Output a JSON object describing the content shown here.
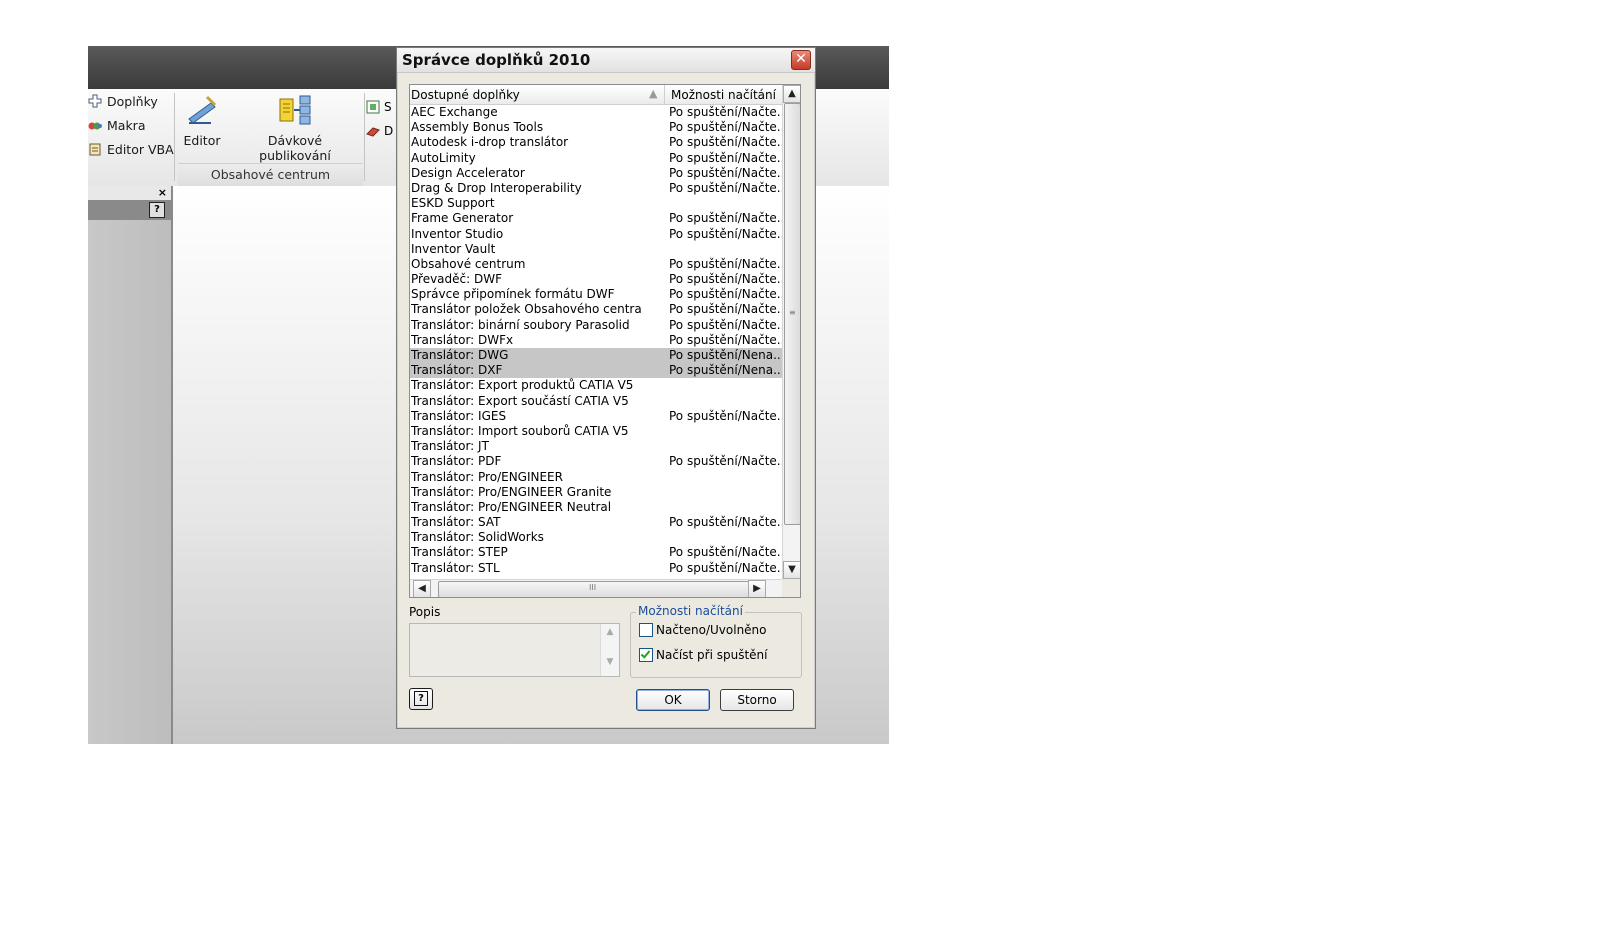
{
  "app": {
    "ribbon": {
      "small_items": [
        {
          "label": "Doplňky",
          "icon": "plus-icon"
        },
        {
          "label": "Makra",
          "icon": "macro-icon"
        },
        {
          "label": "Editor VBA",
          "icon": "vba-icon"
        }
      ],
      "big_buttons": [
        {
          "label": "Editor",
          "icon": "editor-pen-icon"
        },
        {
          "label": "Dávkové publikování",
          "icon": "batch-publish-icon"
        }
      ],
      "group_label": "Obsahové centrum",
      "partial_items": [
        "S",
        "D"
      ]
    }
  },
  "dialog": {
    "title": "Správce doplňků 2010",
    "columns": {
      "name": "Dostupné doplňky",
      "load": "Možnosti načítání"
    },
    "rows": [
      {
        "name": "AEC Exchange",
        "load": "Po spuštění/Načte..."
      },
      {
        "name": "Assembly Bonus Tools",
        "load": "Po spuštění/Načte..."
      },
      {
        "name": "Autodesk i-drop translátor",
        "load": "Po spuštění/Načte..."
      },
      {
        "name": "AutoLimity",
        "load": "Po spuštění/Načte..."
      },
      {
        "name": "Design Accelerator",
        "load": "Po spuštění/Načte..."
      },
      {
        "name": "Drag & Drop Interoperability",
        "load": "Po spuštění/Načte..."
      },
      {
        "name": "ESKD Support",
        "load": ""
      },
      {
        "name": "Frame Generator",
        "load": "Po spuštění/Načte..."
      },
      {
        "name": "Inventor Studio",
        "load": "Po spuštění/Načte..."
      },
      {
        "name": "Inventor Vault",
        "load": ""
      },
      {
        "name": "Obsahové centrum",
        "load": "Po spuštění/Načte..."
      },
      {
        "name": "Převaděč: DWF",
        "load": "Po spuštění/Načte..."
      },
      {
        "name": "Správce připomínek formátu DWF",
        "load": "Po spuštění/Načte..."
      },
      {
        "name": "Translátor položek Obsahového centra",
        "load": "Po spuštění/Načte..."
      },
      {
        "name": "Translátor: binární soubory Parasolid",
        "load": "Po spuštění/Načte..."
      },
      {
        "name": "Translátor: DWFx",
        "load": "Po spuštění/Načte..."
      },
      {
        "name": "Translátor: DWG",
        "load": "Po spuštění/Nena...",
        "selected": true
      },
      {
        "name": "Translátor: DXF",
        "load": "Po spuštění/Nena...",
        "selected": true
      },
      {
        "name": "Translátor: Export produktů CATIA V5",
        "load": ""
      },
      {
        "name": "Translátor: Export součástí CATIA V5",
        "load": ""
      },
      {
        "name": "Translátor: IGES",
        "load": "Po spuštění/Načte..."
      },
      {
        "name": "Translátor: Import souborů CATIA V5",
        "load": ""
      },
      {
        "name": "Translátor: JT",
        "load": ""
      },
      {
        "name": "Translátor: PDF",
        "load": "Po spuštění/Načte..."
      },
      {
        "name": "Translátor: Pro/ENGINEER",
        "load": ""
      },
      {
        "name": "Translátor: Pro/ENGINEER Granite",
        "load": ""
      },
      {
        "name": "Translátor: Pro/ENGINEER Neutral",
        "load": ""
      },
      {
        "name": "Translátor: SAT",
        "load": "Po spuštění/Načte..."
      },
      {
        "name": "Translátor: SolidWorks",
        "load": ""
      },
      {
        "name": "Translátor: STEP",
        "load": "Po spuštění/Načte..."
      },
      {
        "name": "Translátor: STL",
        "load": "Po spuštění/Načte..."
      }
    ],
    "description_label": "Popis",
    "load_group": {
      "legend": "Možnosti načítání",
      "loaded_label": "Načteno/Uvolněno",
      "loaded_checked": false,
      "startup_label": "Načíst při spuštění",
      "startup_checked": true
    },
    "ok_label": "OK",
    "cancel_label": "Storno",
    "scrollbar_grip": "III"
  }
}
